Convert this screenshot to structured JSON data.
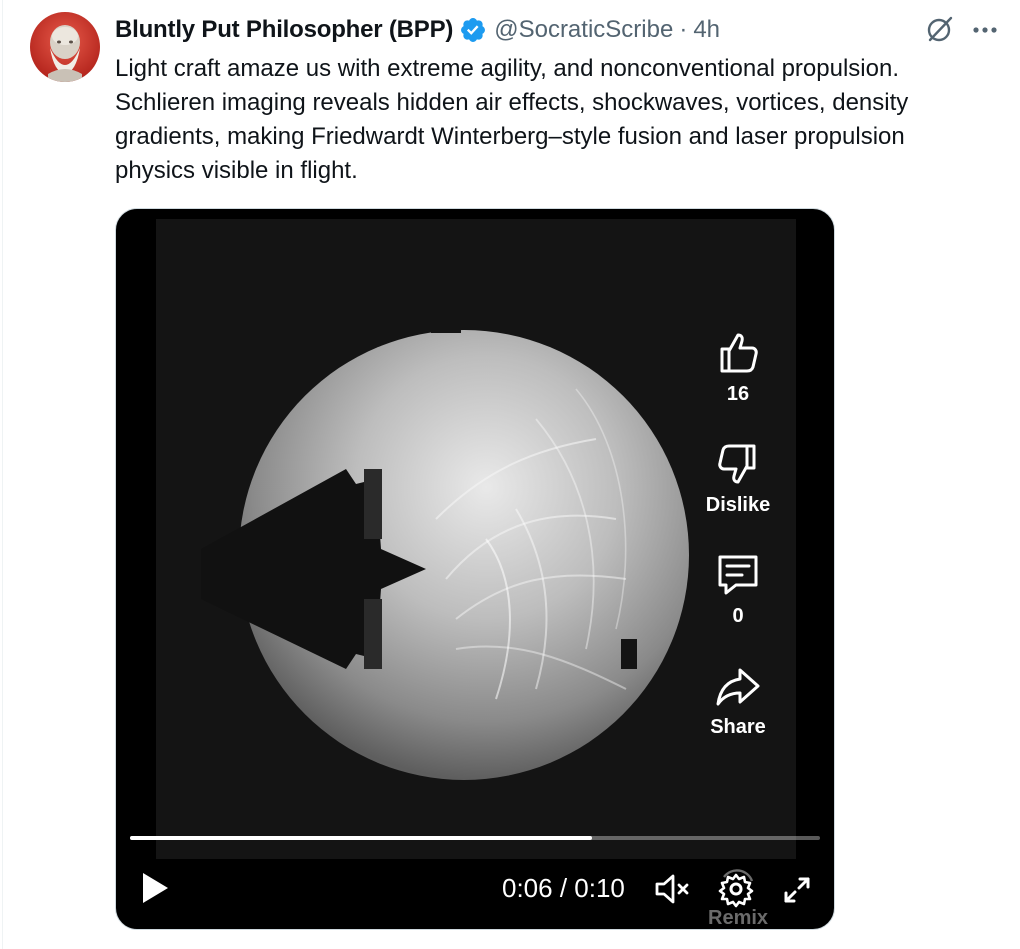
{
  "post": {
    "display_name": "Bluntly Put Philosopher (BPP)",
    "handle": "@SocraticScribe",
    "separator": "·",
    "time": "4h",
    "text": "Light craft amaze us with extreme agility, and nonconventional propulsion.\nSchlieren imaging reveals hidden air effects, shockwaves, vortices, density\ngradients, making Friedwardt Winterberg–style fusion and laser propulsion\nphysics visible in flight."
  },
  "video": {
    "likes": "16",
    "dislike_label": "Dislike",
    "comments": "0",
    "share_label": "Share",
    "remix_label": "Remix",
    "time_display": "0:06 / 0:10",
    "progress": 0.67
  },
  "icons": {
    "verified": "verified-badge-icon",
    "grok": "grok-icon",
    "more": "more-icon",
    "like": "thumbs-up-icon",
    "dislike": "thumbs-down-icon",
    "comment": "comment-icon",
    "share": "share-icon",
    "play": "play-icon",
    "mute": "mute-icon",
    "settings": "gear-icon",
    "expand": "expand-icon"
  },
  "colors": {
    "accent": "#1d9bf0",
    "text": "#0f1419",
    "secondary_text": "#536471"
  }
}
